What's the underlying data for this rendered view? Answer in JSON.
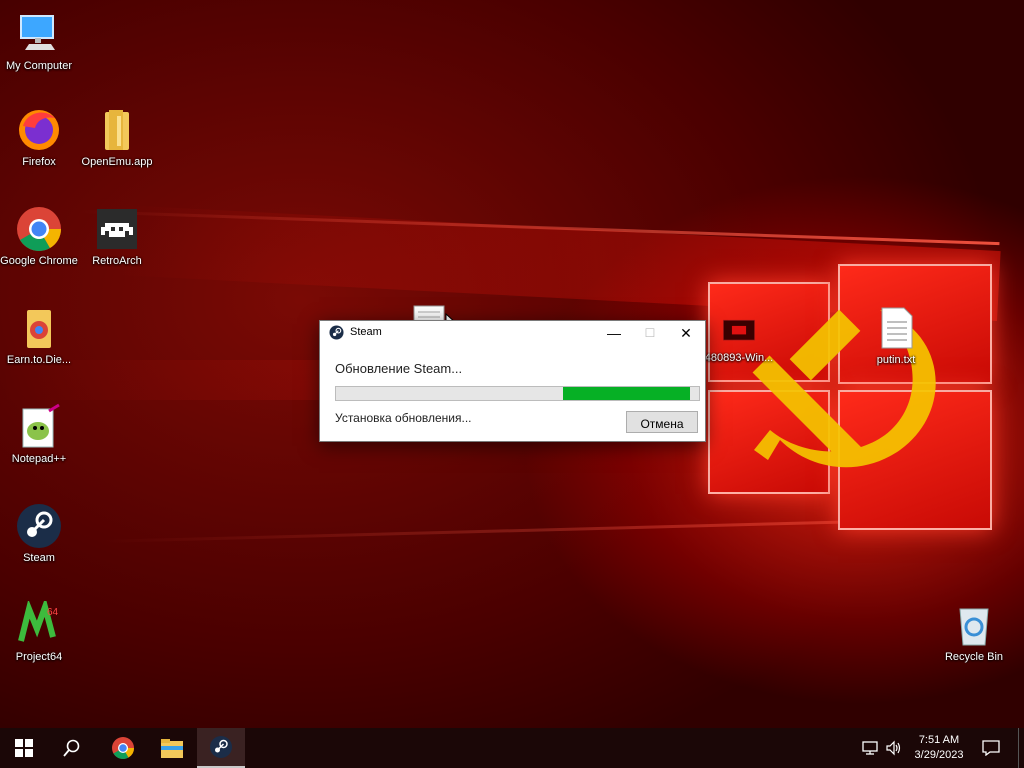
{
  "desktop": {
    "icons": [
      {
        "label": "My Computer"
      },
      {
        "label": "Firefox"
      },
      {
        "label": "OpenEmu.app"
      },
      {
        "label": "Google Chrome"
      },
      {
        "label": "RetroArch"
      },
      {
        "label": "Earn.to.Die..."
      },
      {
        "label": "Notepad++"
      },
      {
        "label": "Steam"
      },
      {
        "label": "Project64"
      },
      {
        "label": "480893-Win..."
      },
      {
        "label": "putin.txt"
      },
      {
        "label": "Recycle Bin"
      }
    ]
  },
  "dialog": {
    "title": "Steam",
    "heading": "Обновление Steam...",
    "status": "Установка обновления...",
    "cancel_label": "Отмена",
    "progress": {
      "start": 0.626,
      "end": 0.974
    },
    "controls": {
      "minimize": "—",
      "maximize": "☐",
      "close": "✕"
    }
  },
  "taskbar": {
    "items": [
      "start-icon",
      "search-icon",
      "chrome-icon",
      "file-explorer-icon",
      "steam-icon"
    ],
    "active": "steam-icon"
  },
  "tray": {
    "time": "7:51 AM",
    "date": "3/29/2023",
    "icons": [
      "network-icon",
      "volume-icon",
      "notifications-icon"
    ]
  },
  "colors": {
    "progress_fill": "#06b025",
    "taskbar": "#1b0707",
    "wallpaper_glow": "#ff2a1a"
  }
}
